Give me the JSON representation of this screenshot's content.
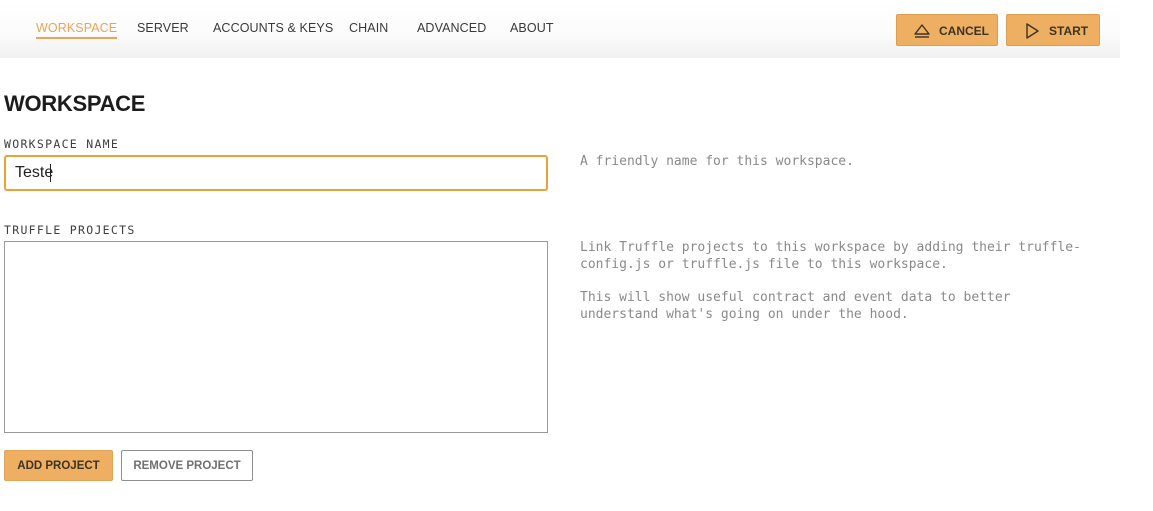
{
  "nav": {
    "tabs": [
      {
        "label": "WORKSPACE",
        "active": true
      },
      {
        "label": "SERVER",
        "active": false
      },
      {
        "label": "ACCOUNTS & KEYS",
        "active": false
      },
      {
        "label": "CHAIN",
        "active": false
      },
      {
        "label": "ADVANCED",
        "active": false
      },
      {
        "label": "ABOUT",
        "active": false
      }
    ],
    "cancel_label": "CANCEL",
    "cancel_icon": "eject-icon",
    "start_label": "START",
    "start_icon": "play-icon"
  },
  "colors": {
    "accent": "#efaf62",
    "active_tab": "#e8a45a",
    "focus_border": "#e8a338",
    "help_text": "#8a8a8a"
  },
  "page": {
    "title": "WORKSPACE"
  },
  "workspace_name": {
    "label": "WORKSPACE NAME",
    "value": "Teste",
    "help": "A friendly name for this workspace."
  },
  "truffle_projects": {
    "label": "TRUFFLE PROJECTS",
    "items": [],
    "help_1": "Link Truffle projects to this workspace by adding their truffle-\nconfig.js or truffle.js file to this workspace.",
    "help_2": "This will show useful contract and event data to better\nunderstand what's going on under the hood.",
    "add_label": "ADD PROJECT",
    "remove_label": "REMOVE PROJECT"
  }
}
